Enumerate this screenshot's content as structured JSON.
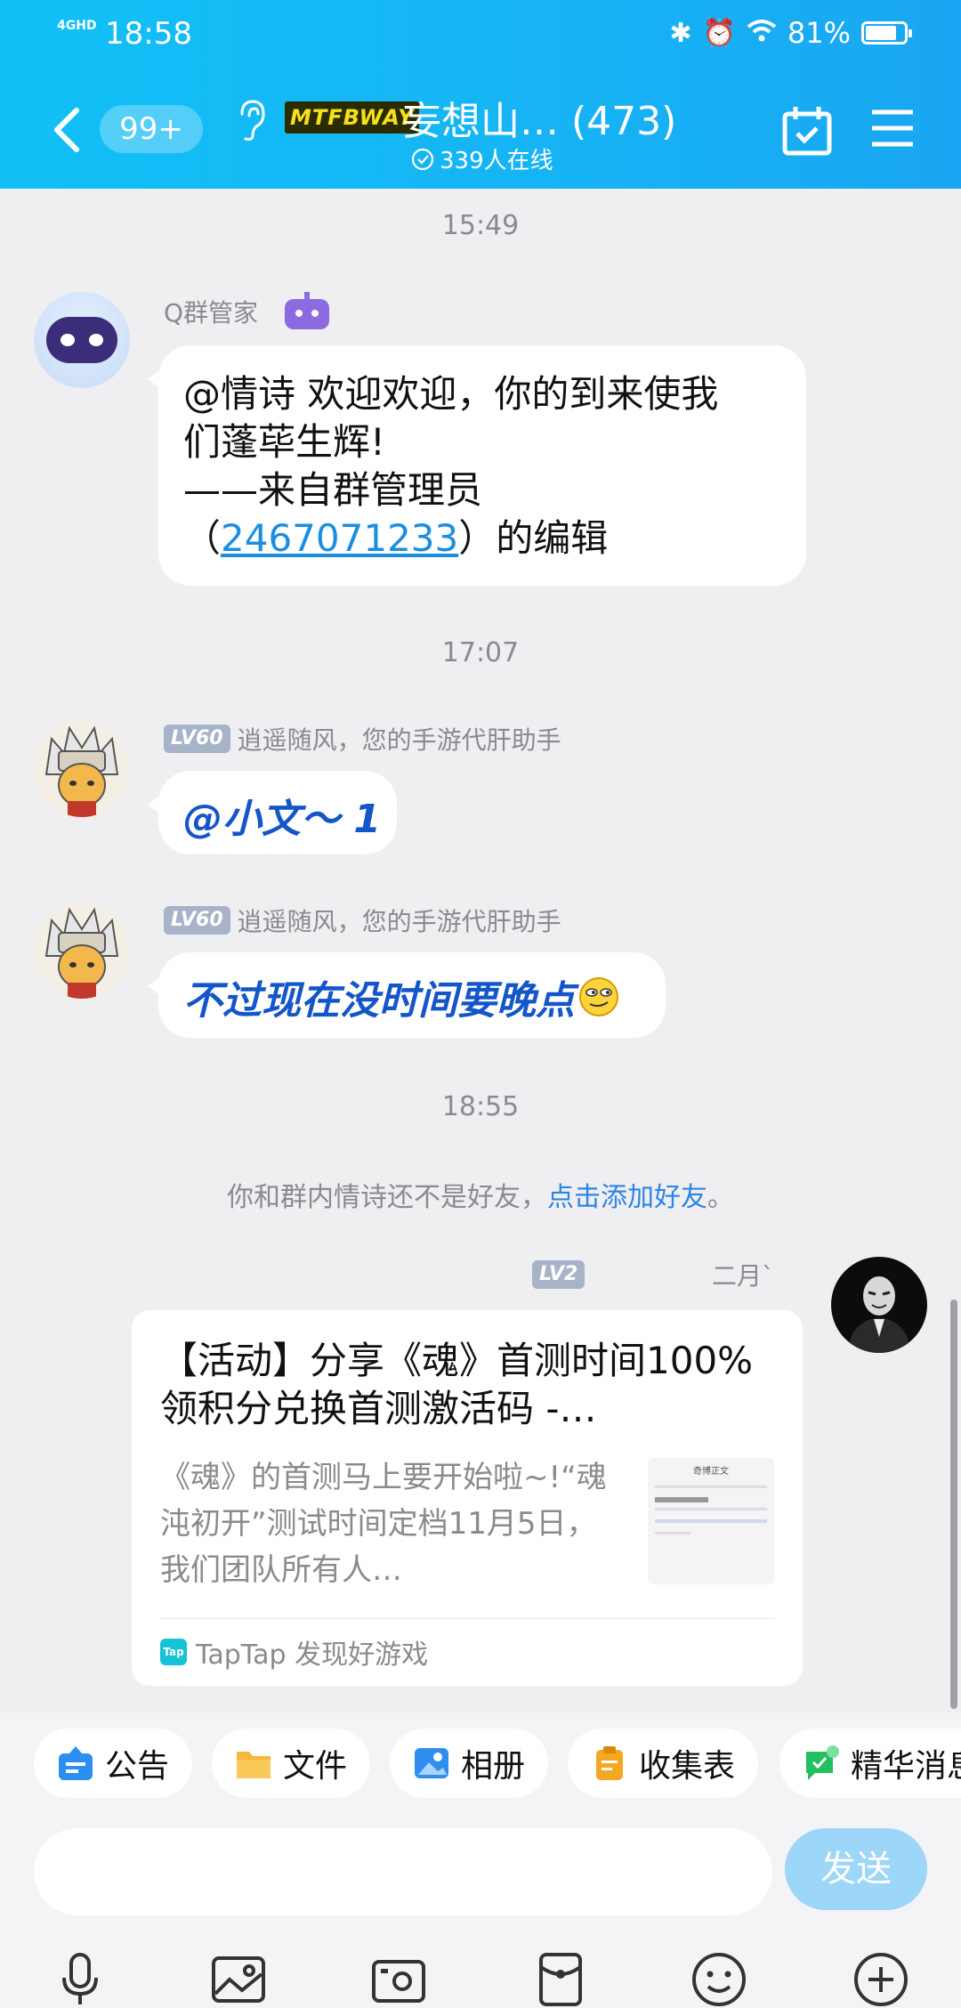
{
  "status_bar": {
    "network": "4GHD",
    "time": "18:58",
    "battery": "81%",
    "battery_level": 0.81
  },
  "header": {
    "unread_badge": "99+",
    "group_logo": "MTFBWAY",
    "group_name": "妄想山…  (473)",
    "online_count": "339人在线",
    "icons": [
      "back-icon",
      "ear-icon",
      "calendar-check-icon",
      "menu-icon"
    ]
  },
  "messages": {
    "time1": "15:49",
    "bot": {
      "name": "Q群管家",
      "line1": "@情诗 欢迎欢迎，你的到来使我",
      "line2": "们蓬荜生辉!",
      "line3": "——来自群管理员",
      "line4_open": "（",
      "line4_link": "2467071233",
      "line4_close": "）的编辑"
    },
    "time2": "17:07",
    "msg1": {
      "level": "LV60",
      "name": "逍遥随风，您的手游代肝助手",
      "text": "@小文～ 1"
    },
    "msg2": {
      "level": "LV60",
      "name": "逍遥随风，您的手游代肝助手",
      "text": "不过现在没时间要晚点"
    },
    "time3": "18:55",
    "notice_prefix": "你和群内情诗还不是好友，",
    "notice_link": "点击添加好友",
    "notice_suffix": "。",
    "share": {
      "level": "LV2",
      "name": "二月`",
      "title": "【活动】分享《魂》首测时间100%领积分兑换首测激活码 -…",
      "desc": "《魂》的首测马上要开始啦~!“魂沌初开”测试时间定档11月5日，我们团队所有人…",
      "thumb_title": "奇博正文",
      "source": "TapTap 发现好游戏",
      "source_icon": "Tap"
    }
  },
  "quick_bar": [
    {
      "label": "公告",
      "icon": "announcement-icon",
      "color": "#2a8ff0"
    },
    {
      "label": "文件",
      "icon": "folder-icon",
      "color": "#f6b73c"
    },
    {
      "label": "相册",
      "icon": "album-icon",
      "color": "#2f8df0"
    },
    {
      "label": "收集表",
      "icon": "clipboard-icon",
      "color": "#f5a623"
    },
    {
      "label": "精华消息",
      "icon": "essence-icon",
      "color": "#22c05e"
    }
  ],
  "input": {
    "placeholder": "",
    "send_label": "发送"
  },
  "toolbar": [
    "microphone-icon",
    "image-icon",
    "camera-icon",
    "red-packet-icon",
    "emoji-icon",
    "plus-icon"
  ]
}
